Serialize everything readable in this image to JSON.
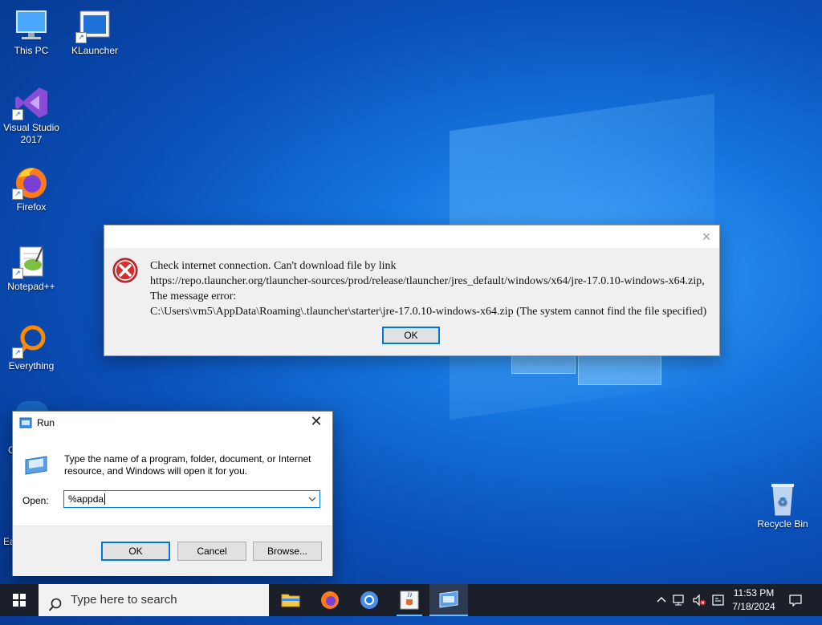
{
  "desktop": {
    "icons": [
      {
        "label": "This PC"
      },
      {
        "label": "KLauncher"
      },
      {
        "label": "Visual Studio 2017"
      },
      {
        "label": "Firefox"
      },
      {
        "label": "Notepad++"
      },
      {
        "label": "Everything"
      },
      {
        "label": "Recycle Bin"
      }
    ],
    "partial_labels": {
      "left_a": "C",
      "left_b": "Ea"
    }
  },
  "error_dialog": {
    "lines": [
      "Check internet connection. Can't download file by link",
      "https://repo.tlauncher.org/tlauncher-sources/prod/release/tlauncher/jres_default/windows/x64/jre-17.0.10-windows-x64.zip,",
      "The message error:",
      "C:\\Users\\vm5\\AppData\\Roaming\\.tlauncher\\starter\\jre-17.0.10-windows-x64.zip (The system cannot find the file specified)"
    ],
    "ok_label": "OK",
    "close_glyph": "×"
  },
  "run_dialog": {
    "title": "Run",
    "close_glyph": "✕",
    "description": "Type the name of a program, folder, document, or Internet resource, and Windows will open it for you.",
    "open_label": "Open:",
    "input_value": "%appda",
    "ok_label": "OK",
    "cancel_label": "Cancel",
    "browse_label": "Browse..."
  },
  "taskbar": {
    "search_placeholder": "Type here to search",
    "apps": [
      {
        "name": "file-explorer-icon"
      },
      {
        "name": "firefox-icon"
      },
      {
        "name": "chrome-icon"
      },
      {
        "name": "java-icon"
      },
      {
        "name": "run-dialog-icon",
        "active": true
      }
    ],
    "time": "11:53 PM",
    "date": "7/18/2024"
  },
  "colors": {
    "accent": "#0078d7",
    "error_red": "#d32f2f",
    "taskbar_bg": "#1b1f2a"
  }
}
